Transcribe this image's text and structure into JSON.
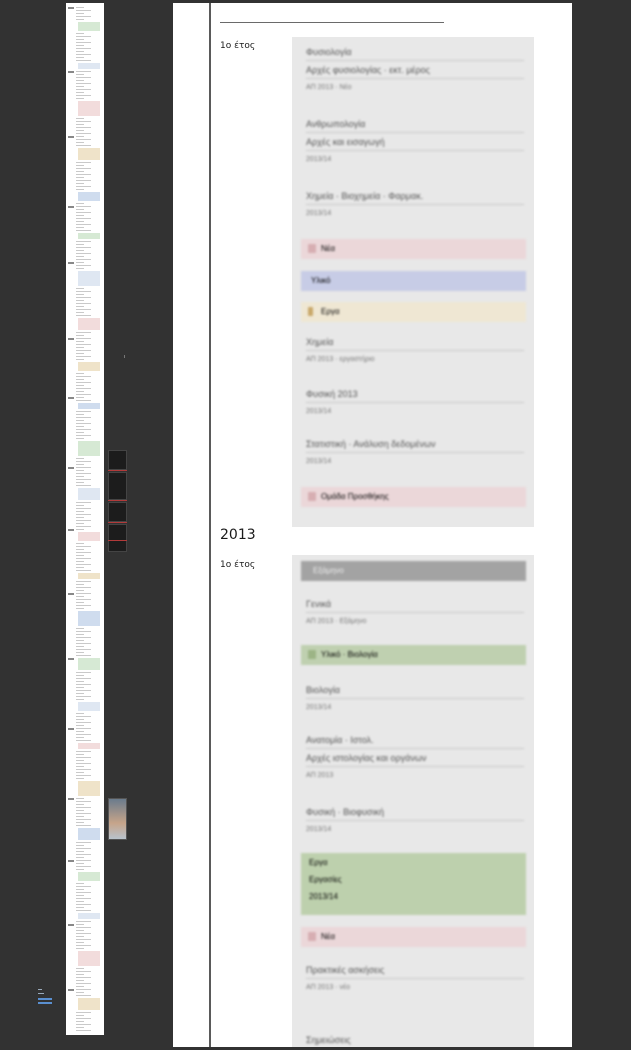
{
  "sections": [
    {
      "year": "",
      "term": "1ο έτος"
    },
    {
      "year": "2013",
      "term": "1ο έτος"
    }
  ],
  "panel1": {
    "items": [
      {
        "title": "Φυσιολογία",
        "line": "Αρχές φυσιολογίας · εκτ. μέρος",
        "sub": "ΑΠ 2013 · Νέο"
      },
      {
        "title": "Ανθρωπολογία",
        "line": "Αρχές και εισαγωγή",
        "sub": "2013/14"
      },
      {
        "title": "Χημεία · Βιοχημεία · Φαρμακ.",
        "line": "",
        "sub": "2013/14"
      },
      {
        "title": "Χημεία",
        "line": "ΑΠ 2013 · εργαστήριο",
        "sub": ""
      },
      {
        "title": "Φυσική 2013",
        "line": "",
        "sub": "2013/14"
      },
      {
        "title": "Στατιστική · Ανάλυση δεδομένων",
        "line": "",
        "sub": "2013/14"
      }
    ],
    "bands": [
      {
        "label": "Νέα",
        "color": "#ebd7d9",
        "icon": "#d7aeb2",
        "icon_name": "note-icon"
      },
      {
        "label": "Υλικό",
        "color": "#c7cce6",
        "icon": "",
        "icon_name": ""
      },
      {
        "label": "Εργα",
        "color": "#efe7d3",
        "icon": "#c9a86a",
        "icon_name": "bookmark-icon"
      },
      {
        "label": "Ομάδα Προσθήκης",
        "color": "#ebd7d9",
        "icon": "#d7aeb2",
        "icon_name": "note-icon"
      }
    ]
  },
  "panel2": {
    "header": {
      "label": "Εξάμηνο",
      "color": "#a3a3a3"
    },
    "items": [
      {
        "title": "Γενικά",
        "line": "ΑΠ 2013 · Εξάμηνο",
        "sub": ""
      },
      {
        "title": "Βιολογία",
        "line": "",
        "sub": "2013/14"
      },
      {
        "title": "Ανατομία · Ιστολ.",
        "line": "Αρχές ιστολογίας και οργάνων",
        "sub": "ΑΠ 2013"
      },
      {
        "title": "Φυσική · Βιοφυσική",
        "line": "",
        "sub": "2013/14"
      },
      {
        "title": "Πρακτικές ασκήσεις",
        "line": "",
        "sub": "ΑΠ 2013 · νέο"
      },
      {
        "title": "Σημειώσεις",
        "line": "",
        "sub": ""
      }
    ],
    "bands": [
      {
        "label": "Υλικό · Βιολογία",
        "color": "#bfd0b0",
        "icon": "#9cb485",
        "icon_name": "folder-icon"
      },
      {
        "label": "Νέα",
        "color": "#ebd7d9",
        "icon": "#d7aeb2",
        "icon_name": "note-icon"
      }
    ],
    "green_block": {
      "title": "Εργα",
      "line1": "Εργασίες",
      "line2": "2013/14",
      "color": "#bdd0ad"
    }
  }
}
